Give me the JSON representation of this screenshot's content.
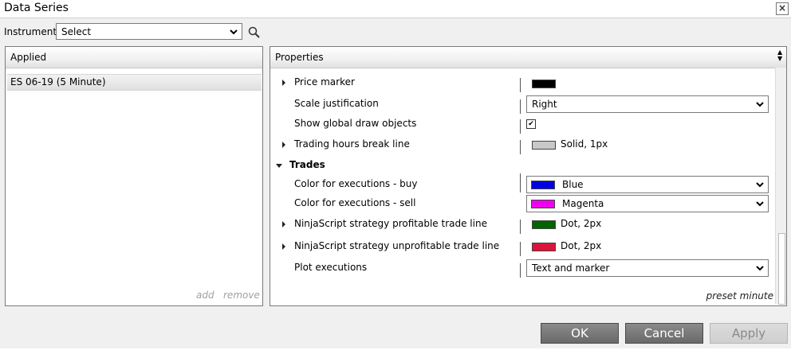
{
  "window": {
    "title": "Data Series",
    "close_label": "×"
  },
  "toolbar": {
    "instrument_label": "Instrument",
    "instrument_value": "Select"
  },
  "applied": {
    "header": "Applied",
    "items": [
      "ES 06-19 (5 Minute)"
    ],
    "add_label": "add",
    "remove_label": "remove"
  },
  "properties": {
    "header": "Properties",
    "rows": {
      "price_marker": {
        "label": "Price marker",
        "value_color": "#000000"
      },
      "scale_justification": {
        "label": "Scale justification",
        "value": "Right"
      },
      "show_global_draw_objects": {
        "label": "Show global draw objects",
        "checked": true
      },
      "trading_hours_break_line": {
        "label": "Trading hours break line",
        "value": "Solid, 1px",
        "value_color": "#c8c8c8"
      },
      "trades_category": {
        "label": "Trades"
      },
      "color_buy": {
        "label": "Color for executions - buy",
        "value": "Blue",
        "value_color": "#0000e0"
      },
      "color_sell": {
        "label": "Color for executions - sell",
        "value": "Magenta",
        "value_color": "#ee00ee"
      },
      "profitable_line": {
        "label": "NinjaScript strategy profitable trade line",
        "value": "Dot, 2px",
        "value_color": "#006400"
      },
      "unprofitable_line": {
        "label": "NinjaScript strategy unprofitable trade line",
        "value": "Dot, 2px",
        "value_color": "#dc143c"
      },
      "plot_executions": {
        "label": "Plot executions",
        "value": "Text and marker"
      }
    },
    "preset_label": "preset minute"
  },
  "buttons": {
    "ok": "OK",
    "cancel": "Cancel",
    "apply": "Apply"
  }
}
